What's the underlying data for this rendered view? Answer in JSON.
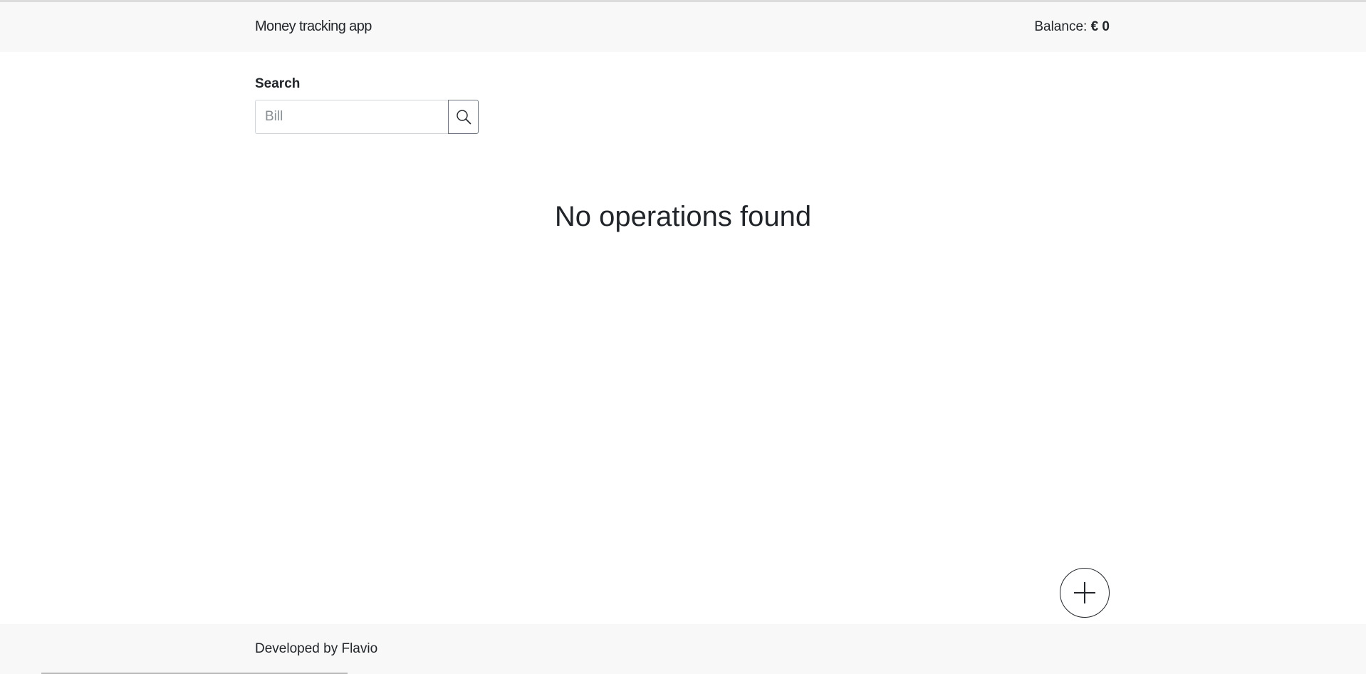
{
  "header": {
    "app_title": "Money tracking app",
    "balance_label": "Balance:",
    "balance_value": "€ 0"
  },
  "search": {
    "label": "Search",
    "placeholder": "Bill",
    "value": "",
    "button_icon": "search-icon"
  },
  "main": {
    "empty_message": "No operations found",
    "add_button_icon": "plus-icon"
  },
  "footer": {
    "text": "Developed by Flavio"
  },
  "colors": {
    "header_bg": "#f8f8f8",
    "footer_bg": "#f8f8f8",
    "text": "#212529",
    "input_border": "#ced4da",
    "button_border": "#6c757d"
  }
}
